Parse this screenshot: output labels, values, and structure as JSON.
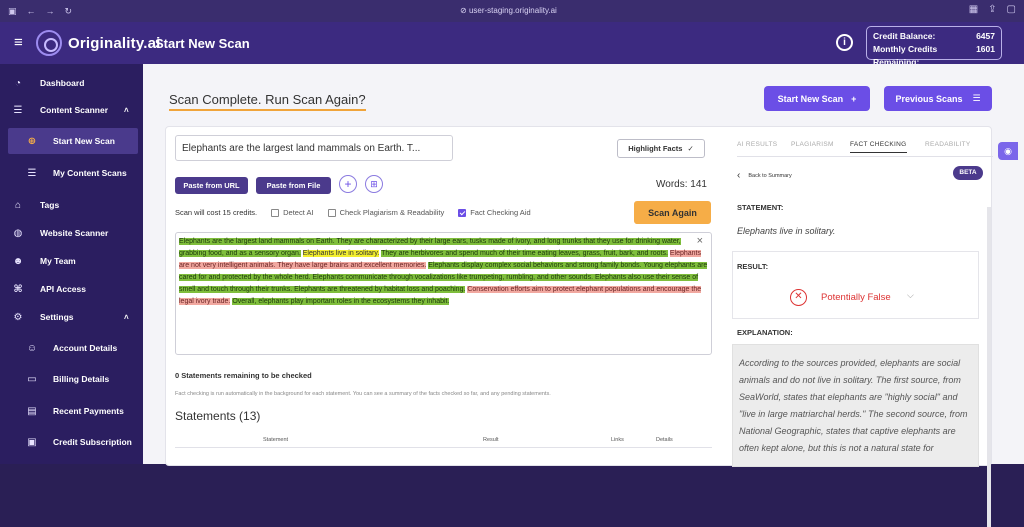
{
  "browser": {
    "url": "user-staging.originality.ai"
  },
  "header": {
    "brand": "Originality.ai",
    "title": "Start New Scan",
    "credit_balance_label": "Credit Balance:",
    "credit_balance_value": "6457",
    "monthly_label": "Monthly Credits Remaining:",
    "monthly_value": "1601"
  },
  "sidebar": {
    "items": [
      {
        "label": "Dashboard",
        "icon": "dashboard-icon"
      },
      {
        "label": "Content Scanner",
        "icon": "list-icon"
      },
      {
        "label": "Start New Scan",
        "icon": "plus-circle-icon"
      },
      {
        "label": "My Content Scans",
        "icon": "list-icon"
      },
      {
        "label": "Tags",
        "icon": "tag-icon"
      },
      {
        "label": "Website Scanner",
        "icon": "globe-icon"
      },
      {
        "label": "My Team",
        "icon": "team-icon"
      },
      {
        "label": "API Access",
        "icon": "api-icon"
      },
      {
        "label": "Settings",
        "icon": "gear-icon"
      },
      {
        "label": "Account Details",
        "icon": "user-icon"
      },
      {
        "label": "Billing Details",
        "icon": "card-icon"
      },
      {
        "label": "Recent Payments",
        "icon": "receipt-icon"
      },
      {
        "label": "Credit Subscription",
        "icon": "subscription-icon"
      }
    ]
  },
  "main": {
    "heading": "Scan Complete. Run Scan Again?",
    "start_new_scan": "Start New Scan",
    "previous_scans": "Previous Scans",
    "title_value": "Elephants are the largest land mammals on Earth. T...",
    "highlight_facts": "Highlight Facts",
    "paste_url": "Paste from URL",
    "paste_file": "Paste from File",
    "words": "Words: 141",
    "cost": "Scan will cost 15 credits.",
    "detect_ai": "Detect AI",
    "plagiarism": "Check Plagiarism & Readability",
    "fact_check": "Fact Checking Aid",
    "scan_again": "Scan Again",
    "text_segments": [
      {
        "text": "Elephants are the largest land mammals on Earth. They are characterized by their large ears, tusks made of ivory, and long trunks that they use for drinking water, grabbing food, and as a sensory organ.",
        "c": "g"
      },
      {
        "text": " ",
        "c": "t"
      },
      {
        "text": "Elephants live in solitary.",
        "c": "y"
      },
      {
        "text": " ",
        "c": "t"
      },
      {
        "text": "They are herbivores and spend much of their time eating leaves, grass, fruit, bark, and roots.",
        "c": "g"
      },
      {
        "text": " ",
        "c": "t"
      },
      {
        "text": "Elephants are not very intelligent animals. They have large brains and excellent memories.",
        "c": "p"
      },
      {
        "text": " ",
        "c": "t"
      },
      {
        "text": "Elephants display complex social behaviors and strong family bonds. Young elephants are cared for and protected by the whole herd. Elephants communicate through vocalizations like trumpeting, rumbling, and other sounds. Elephants also use their sense of smell and touch through their trunks. Elephants are threatened by habitat loss and poaching.",
        "c": "g"
      },
      {
        "text": " ",
        "c": "t"
      },
      {
        "text": "Conservation efforts aim to protect elephant populations and encourage the legal ivory trade.",
        "c": "p"
      },
      {
        "text": " ",
        "c": "t"
      },
      {
        "text": "Overall, elephants play important roles in the ecosystems they inhabit.",
        "c": "g"
      }
    ],
    "remaining": "0 Statements remaining to be checked",
    "note": "Fact checking is run automatically in the background for each statement. You can see a summary of the facts checked so far, and any pending statements.",
    "statements_title": "Statements (13)",
    "columns": [
      "Statement",
      "Result",
      "Links",
      "Details"
    ]
  },
  "panel": {
    "tabs": [
      "AI RESULTS",
      "PLAGIARISM",
      "FACT CHECKING",
      "READABILITY"
    ],
    "back": "Back to Summary",
    "beta": "BETA",
    "statement_label": "STATEMENT:",
    "statement": "Elephants live in solitary.",
    "result_label": "RESULT:",
    "result": "Potentially False",
    "explanation_label": "EXPLANATION:",
    "explanation": "According to the sources provided, elephants are social animals and do not live in solitary. The first source, from SeaWorld, states that elephants are \"highly social\" and \"live in large matriarchal herds.\" The second source, from National Geographic, states that captive elephants are often kept alone, but this is not a natural state for"
  },
  "colors": {
    "accent": "#6b4ee6",
    "sidebar": "#2b1e60",
    "scan_again": "#f6ad47",
    "false": "#dd3333"
  }
}
